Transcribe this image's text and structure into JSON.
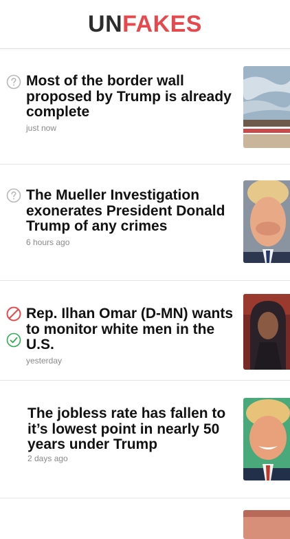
{
  "app": {
    "logo_part1": "UN",
    "logo_part2": "FAKES"
  },
  "colors": {
    "brand_red": "#e5484d",
    "brand_dark": "#2d2d2d",
    "true_green": "#2eaa4f",
    "false_red": "#e5484d",
    "unknown_gray": "#b8b8b8"
  },
  "feed": {
    "items": [
      {
        "title": "Most of the border wall proposed by Trump is already complete",
        "time": "just now",
        "status_icons": [
          "question-circle-icon"
        ],
        "thumbnail": "border-wall-photo"
      },
      {
        "title": "The Mueller Investigation exonerates President Donald Trump of any crimes",
        "time": "6 hours ago",
        "status_icons": [
          "question-circle-icon"
        ],
        "thumbnail": "trump-portrait-photo"
      },
      {
        "title": "Rep. Ilhan Omar (D-MN) wants to monitor white men in the U.S.",
        "time": "yesterday",
        "status_icons": [
          "no-entry-icon",
          "check-circle-icon"
        ],
        "thumbnail": "ilhan-omar-photo"
      },
      {
        "title": "The jobless rate has fallen to it’s lowest point in nearly 50 years under Trump",
        "time": "2 days ago",
        "status_icons": [],
        "thumbnail": "trump-smiling-photo"
      }
    ]
  }
}
